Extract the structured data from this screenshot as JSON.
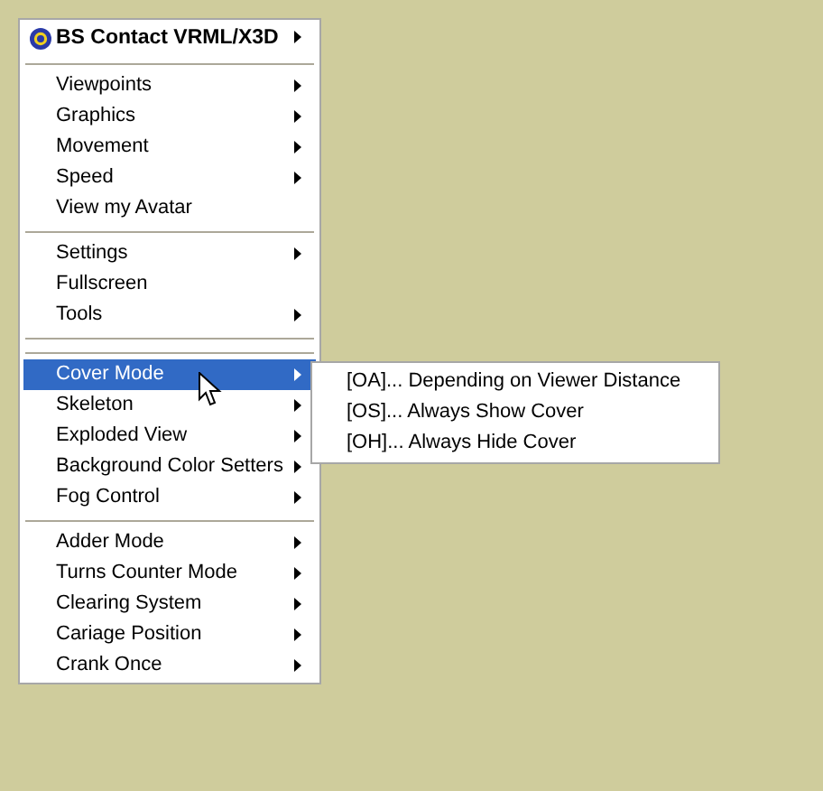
{
  "menu": {
    "header": {
      "title": "BS Contact VRML/X3D",
      "has_submenu": true
    },
    "items": [
      {
        "kind": "separator"
      },
      {
        "kind": "item",
        "label": "Viewpoints",
        "has_submenu": true,
        "selected": false
      },
      {
        "kind": "item",
        "label": "Graphics",
        "has_submenu": true,
        "selected": false
      },
      {
        "kind": "item",
        "label": "Movement",
        "has_submenu": true,
        "selected": false
      },
      {
        "kind": "item",
        "label": "Speed",
        "has_submenu": true,
        "selected": false
      },
      {
        "kind": "item",
        "label": "View my Avatar",
        "has_submenu": false,
        "selected": false
      },
      {
        "kind": "separator"
      },
      {
        "kind": "item",
        "label": "Settings",
        "has_submenu": true,
        "selected": false
      },
      {
        "kind": "item",
        "label": "Fullscreen",
        "has_submenu": false,
        "selected": false
      },
      {
        "kind": "item",
        "label": "Tools",
        "has_submenu": true,
        "selected": false
      },
      {
        "kind": "separator"
      },
      {
        "kind": "separator"
      },
      {
        "kind": "item",
        "label": "Cover Mode",
        "has_submenu": true,
        "selected": true
      },
      {
        "kind": "item",
        "label": "Skeleton",
        "has_submenu": true,
        "selected": false
      },
      {
        "kind": "item",
        "label": "Exploded View",
        "has_submenu": true,
        "selected": false
      },
      {
        "kind": "item",
        "label": "Background Color Setters",
        "has_submenu": true,
        "selected": false
      },
      {
        "kind": "item",
        "label": "Fog Control",
        "has_submenu": true,
        "selected": false
      },
      {
        "kind": "separator"
      },
      {
        "kind": "item",
        "label": "Adder Mode",
        "has_submenu": true,
        "selected": false
      },
      {
        "kind": "item",
        "label": "Turns Counter Mode",
        "has_submenu": true,
        "selected": false
      },
      {
        "kind": "item",
        "label": "Clearing System",
        "has_submenu": true,
        "selected": false
      },
      {
        "kind": "item",
        "label": "Cariage Position",
        "has_submenu": true,
        "selected": false
      },
      {
        "kind": "item",
        "label": "Crank Once",
        "has_submenu": true,
        "selected": false
      }
    ]
  },
  "submenu": {
    "items": [
      {
        "label": "[OA]... Depending on Viewer Distance"
      },
      {
        "label": "[OS]... Always Show Cover"
      },
      {
        "label": "[OH]... Always Hide Cover"
      }
    ]
  }
}
